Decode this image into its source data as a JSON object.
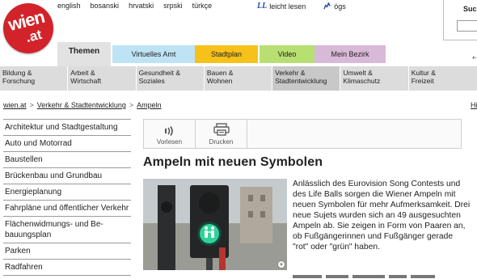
{
  "logo": {
    "line1": "wien",
    "line2": ".at"
  },
  "languages": [
    "english",
    "bosanski",
    "hrvatski",
    "srpski",
    "türkçe"
  ],
  "tools": {
    "easy_read_icon": "LL",
    "easy_read": "leicht lesen",
    "sign_language": "ögs"
  },
  "search": {
    "label": "Such"
  },
  "tabs": [
    "Themen",
    "Virtuelles Amt",
    "Stadtplan",
    "Video",
    "Mein Bezirk"
  ],
  "tab_colors": {
    "themen": "#e2e2e2",
    "virtuelles_amt": "#bee3f5",
    "stadtplan": "#f6c11a",
    "video": "#b7df72",
    "mein_bezirk": "#d9b9d8"
  },
  "categories": [
    {
      "line1": "Bildung &",
      "line2": "Forschung"
    },
    {
      "line1": "Arbeit &",
      "line2": "Wirtschaft"
    },
    {
      "line1": "Gesundheit &",
      "line2": "Soziales"
    },
    {
      "line1": "Bauen &",
      "line2": "Wohnen"
    },
    {
      "line1": "Verkehr &",
      "line2": "Stadtentwicklung"
    },
    {
      "line1": "Umwelt &",
      "line2": "Klimaschutz"
    },
    {
      "line1": "Kultur &",
      "line2": "Freizeit"
    }
  ],
  "breadcrumb": [
    "wien.at",
    "Verkehr & Stadtentwicklung",
    "Ampeln"
  ],
  "breadcrumb_sep": ">",
  "right_cut": "Hi",
  "sidebar": [
    "Architektur und Stadtgestaltung",
    "Auto und Motorrad",
    "Baustellen",
    "Brückenbau und Grundbau",
    "Energieplanung",
    "Fahrpläne und öffentlicher Verkehr",
    "Flächenwidmungs- und Be-bauungsplan",
    "Parken",
    "Radfahren"
  ],
  "toolbar": {
    "read_aloud": "Vorlesen",
    "print": "Drucken"
  },
  "article": {
    "title": "Ampeln mit neuen Symbolen",
    "lead": "Anlässlich des Eurovision Song Contests und des Life Balls sorgen die Wiener Ampeln mit neuen Symbolen für mehr Aufmerksamkeit. Drei neue Sujets wurden sich an 49 ausgesuchten Ampeln ab. Sie zeigen in Form von Paaren an, ob Fußgängerinnen und Fußgänger gerade \"rot\" oder \"grün\" haben."
  },
  "photo": {
    "zoom_icon": "+"
  },
  "accent": "#d2232a"
}
